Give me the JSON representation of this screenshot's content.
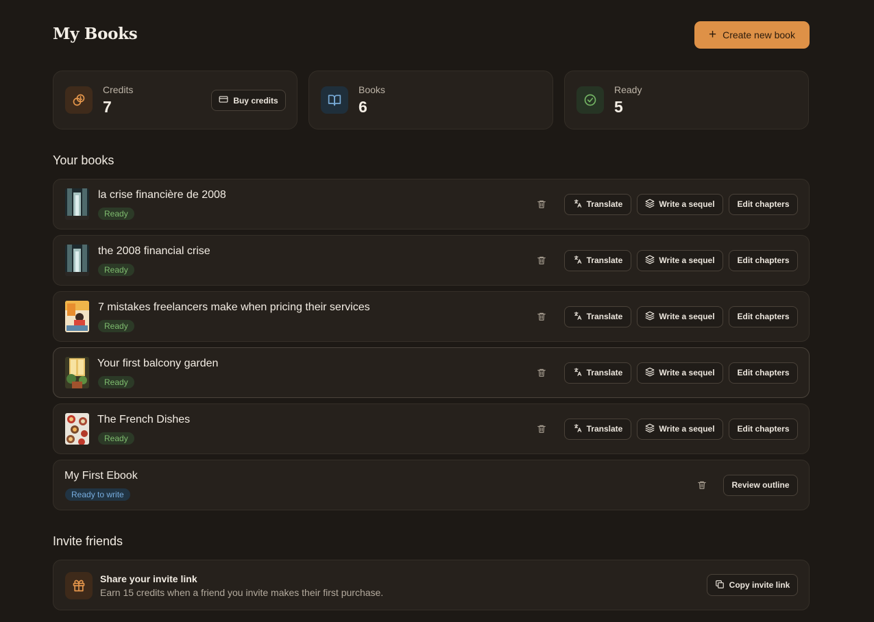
{
  "page_title": "My Books",
  "create_button": "Create new book",
  "stats": {
    "credits": {
      "label": "Credits",
      "value": "7",
      "button": "Buy credits"
    },
    "books": {
      "label": "Books",
      "value": "6"
    },
    "ready": {
      "label": "Ready",
      "value": "5"
    }
  },
  "books_section_title": "Your books",
  "actions": {
    "translate": "Translate",
    "sequel": "Write a sequel",
    "edit": "Edit chapters",
    "review": "Review outline"
  },
  "books": [
    {
      "title": "la crise financière de 2008",
      "status": "Ready"
    },
    {
      "title": "the 2008 financial crise",
      "status": "Ready"
    },
    {
      "title": "7 mistakes freelancers make when pricing their services",
      "status": "Ready"
    },
    {
      "title": "Your first balcony garden",
      "status": "Ready"
    },
    {
      "title": "The French Dishes",
      "status": "Ready"
    },
    {
      "title": "My First Ebook",
      "status": "Ready to write"
    }
  ],
  "invite": {
    "section_title": "Invite friends",
    "title": "Share your invite link",
    "subtitle": "Earn 15 credits when a friend you invite makes their first purchase.",
    "button": "Copy invite link"
  },
  "colors": {
    "background": "#1d1915",
    "card": "#26211c",
    "accent": "#de9147",
    "ready_badge": "#7ebb6e",
    "write_badge": "#78aee0"
  }
}
